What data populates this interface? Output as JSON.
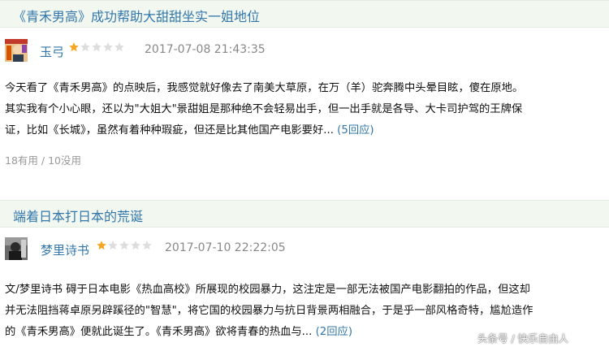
{
  "reviews": [
    {
      "title": "《青禾男高》成功帮助大甜甜坐实一姐地位",
      "author": "玉弓",
      "rating": 1,
      "rating_max": 5,
      "time": "2017-07-08 21:43:35",
      "lines": [
        "今天看了《青禾男高》的点映后，我感觉就好像去了南美大草原，在万（羊）驼奔腾中头晕目眩，傻在原地。",
        "其实我有个小心眼，还以为\"大姐大\"景甜姐是那种绝不会轻易出手，但一出手就是各导、大卡司护驾的王牌保",
        "证，比如《长城》，虽然有着种种瑕疵，但还是比其他国产电影要好..."
      ],
      "reply_label": "(5回应)",
      "votes": "18有用 / 10没用"
    },
    {
      "title": "端着日本打日本的荒诞",
      "author": "梦里诗书",
      "rating": 1,
      "rating_max": 5,
      "time": "2017-07-10 22:22:05",
      "lines": [
        "文/梦里诗书 碍于日本电影《热血高校》所展现的校园暴力，这注定是一部无法被国产电影翻拍的作品，但这却",
        "并无法阻挡蒋卓原另辟蹊径的\"智慧\"，将它国的校园暴力与抗日背景两相融合，于是乎一部风格奇特，尴尬造作",
        "的《青禾男高》便就此诞生了。《青禾男高》欲将青春的热血与..."
      ],
      "reply_label": "(2回应)"
    }
  ],
  "watermark": "头条号 / 快乐自由人",
  "colors": {
    "link": "#3377aa",
    "star_on": "#f5a623",
    "star_off": "#dddddd",
    "title_bg": "#f2f7f0",
    "muted": "#888888"
  }
}
